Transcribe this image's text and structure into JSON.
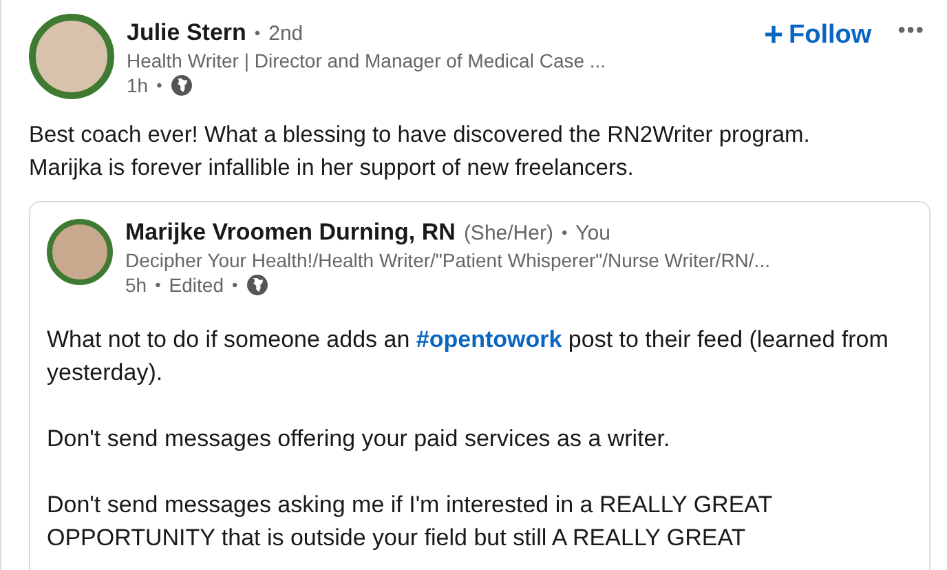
{
  "post": {
    "author": {
      "name": "Julie Stern",
      "name_separator": "•",
      "degree": "2nd",
      "headline": "Health Writer | Director and Manager of Medical Case ...",
      "time": "1h",
      "time_separator": "•"
    },
    "follow": {
      "icon": "+",
      "label": "Follow"
    },
    "menu": "•••",
    "text": [
      "Best coach ever! What a blessing to have discovered the RN2Writer program.",
      "Marijka is forever infallible in her support of new freelancers."
    ],
    "shared_post": {
      "author": {
        "name": "Marijke Vroomen Durning, RN",
        "pronouns": "(She/Her)",
        "name_separator": "•",
        "relation": "You",
        "headline": "Decipher Your Health!/Health Writer/\"Patient Whisperer\"/Nurse Writer/RN/...",
        "time": "5h",
        "time_separator": "•",
        "edited": "Edited",
        "edited_separator": "•"
      },
      "paragraphs": [
        "What not to do if someone adds an **#opentowork** post to their feed (learned from yesterday).",
        "Don't send messages offering your paid services as a writer.",
        "Don't send messages asking me if I'm interested in a REALLY GREAT OPPORTUNITY that is outside your field but still A REALLY GREAT"
      ]
    }
  }
}
